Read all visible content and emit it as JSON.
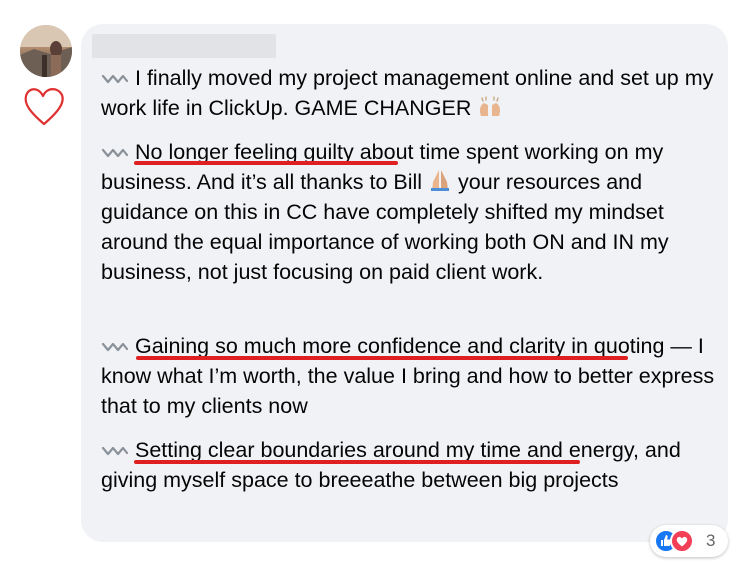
{
  "comment": {
    "author_name": "",
    "paragraphs": [
      {
        "text": "I finally moved my project management online and set up my work life in ClickUp. GAME CHANGER",
        "emoji": "raising-hands"
      },
      {
        "highlight": "No longer feeling guilty",
        "text": " about time spent working on my business. And it’s all thanks to Bill ",
        "emoji": "folded-hands",
        "text_after": " your resources and guidance on this in CC have completely shifted my mindset around the equal importance of working both ON and IN my business, not just focusing on paid client work."
      },
      {
        "highlight": "Gaining so much more confidence and clarity",
        "text": " in quoting — I know what I’m worth, the value I bring and how to better express that to my clients now"
      },
      {
        "highlight": "Setting clear boundaries around my time",
        "text": " and energy, and giving myself space to breeeathe between big projects"
      }
    ],
    "reactions": {
      "types": [
        "like",
        "love"
      ],
      "count": "3"
    }
  },
  "annotation": {
    "heart_color": "#e03030",
    "underline_color": "#e02020"
  }
}
